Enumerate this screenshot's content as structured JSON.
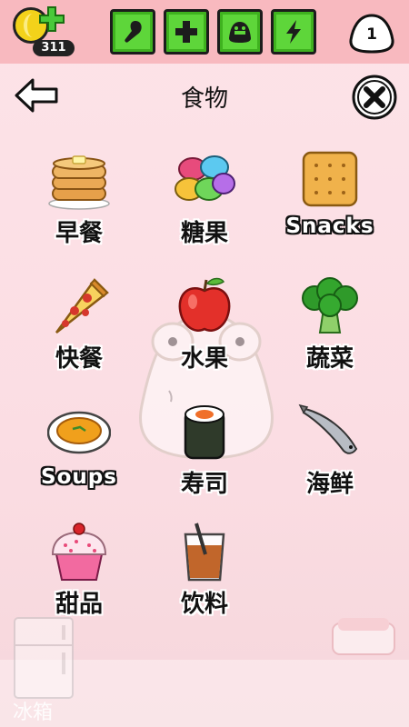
{
  "topbar": {
    "coins": "311",
    "level": "1",
    "room_buttons": [
      "food-room-icon",
      "medicine-room-icon",
      "bath-room-icon",
      "energy-room-icon"
    ],
    "accent": "#5ed63a",
    "bar_color": "#f8b9bf"
  },
  "header": {
    "title": "食物",
    "back_icon": "arrow-left-icon",
    "close_icon": "close-icon"
  },
  "categories": [
    {
      "label": "早餐",
      "icon": "pancakes-icon"
    },
    {
      "label": "糖果",
      "icon": "candy-icon"
    },
    {
      "label": "Snacks",
      "icon": "cracker-icon"
    },
    {
      "label": "快餐",
      "icon": "pizza-icon"
    },
    {
      "label": "水果",
      "icon": "apple-icon"
    },
    {
      "label": "蔬菜",
      "icon": "broccoli-icon"
    },
    {
      "label": "Soups",
      "icon": "soup-icon"
    },
    {
      "label": "寿司",
      "icon": "sushi-icon"
    },
    {
      "label": "海鲜",
      "icon": "fish-icon"
    },
    {
      "label": "甜品",
      "icon": "cupcake-icon"
    },
    {
      "label": "饮料",
      "icon": "drink-icon"
    }
  ],
  "background": {
    "fridge_label": "冰箱"
  }
}
